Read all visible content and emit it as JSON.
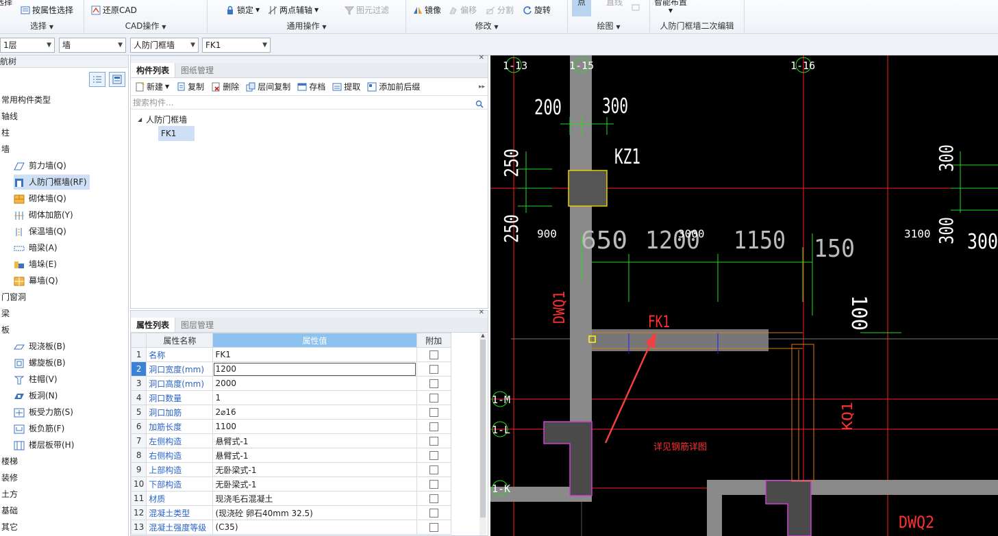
{
  "ribbon": {
    "select_group": {
      "top_partial": "选择",
      "attr_select": "按属性选择",
      "label": "选择"
    },
    "cad_group": {
      "restore_cad": "还原CAD",
      "label": "CAD操作"
    },
    "common_group": {
      "lock": "锁定",
      "two_point_axis": "两点辅轴",
      "element_filter": "图元过滤",
      "label": "通用操作"
    },
    "modify_group": {
      "mirror": "镜像",
      "offset": "偏移",
      "split": "分割",
      "rotate": "旋转",
      "label": "修改"
    },
    "draw_group": {
      "point": "点",
      "line": "直线",
      "label": "绘图"
    },
    "smart_group": {
      "smart_layout": "智能布置",
      "label": "人防门框墙二次编辑"
    }
  },
  "combos": {
    "floor": "1层",
    "category": "墙",
    "type": "人防门框墙",
    "element": "FK1"
  },
  "nav": {
    "title": "导航树",
    "items": [
      {
        "label": "常用构件类型"
      },
      {
        "label": "轴线"
      },
      {
        "label": "柱"
      },
      {
        "label": "墙"
      },
      {
        "label": "剪力墙(Q)",
        "icon": "shear-wall-icon"
      },
      {
        "label": "人防门框墙(RF)",
        "icon": "door-frame-wall-icon"
      },
      {
        "label": "砌体墙(Q)",
        "icon": "masonry-wall-icon"
      },
      {
        "label": "砌体加筋(Y)",
        "icon": "masonry-rebar-icon"
      },
      {
        "label": "保温墙(Q)",
        "icon": "insulation-wall-icon"
      },
      {
        "label": "暗梁(A)",
        "icon": "hidden-beam-icon"
      },
      {
        "label": "墙垛(E)",
        "icon": "wall-pier-icon"
      },
      {
        "label": "幕墙(Q)",
        "icon": "curtain-wall-icon"
      },
      {
        "label": "门窗洞"
      },
      {
        "label": "梁"
      },
      {
        "label": "板"
      },
      {
        "label": "现浇板(B)",
        "icon": "cast-slab-icon"
      },
      {
        "label": "螺旋板(B)",
        "icon": "spiral-slab-icon"
      },
      {
        "label": "柱帽(V)",
        "icon": "column-cap-icon"
      },
      {
        "label": "板洞(N)",
        "icon": "slab-hole-icon"
      },
      {
        "label": "板受力筋(S)",
        "icon": "slab-main-rebar-icon"
      },
      {
        "label": "板负筋(F)",
        "icon": "slab-neg-rebar-icon"
      },
      {
        "label": "楼层板带(H)",
        "icon": "slab-strip-icon"
      },
      {
        "label": "楼梯"
      },
      {
        "label": "装修"
      },
      {
        "label": "土方"
      },
      {
        "label": "基础"
      },
      {
        "label": "其它"
      }
    ]
  },
  "complist": {
    "tabs": [
      "构件列表",
      "图纸管理"
    ],
    "toolbar": {
      "new": "新建",
      "copy": "复制",
      "delete": "删除",
      "floor_copy": "层间复制",
      "archive": "存档",
      "extract": "提取",
      "add_prefix": "添加前后缀"
    },
    "search_placeholder": "搜索构件...",
    "tree_root": "人防门框墙",
    "tree_child": "FK1"
  },
  "proplist": {
    "tabs": [
      "属性列表",
      "图层管理"
    ],
    "headers": {
      "name": "属性名称",
      "value": "属性值",
      "extra": "附加"
    },
    "rows": [
      {
        "n": "1",
        "name": "名称",
        "value": "FK1"
      },
      {
        "n": "2",
        "name": "洞口宽度(mm)",
        "value": "1200"
      },
      {
        "n": "3",
        "name": "洞口高度(mm)",
        "value": "2000"
      },
      {
        "n": "4",
        "name": "洞口数量",
        "value": "1"
      },
      {
        "n": "5",
        "name": "洞口加筋",
        "value": "2⌀16"
      },
      {
        "n": "6",
        "name": "加筋长度",
        "value": "1100"
      },
      {
        "n": "7",
        "name": "左侧构造",
        "value": "悬臂式-1"
      },
      {
        "n": "8",
        "name": "右侧构造",
        "value": "悬臂式-1"
      },
      {
        "n": "9",
        "name": "上部构造",
        "value": "无卧梁式-1"
      },
      {
        "n": "10",
        "name": "下部构造",
        "value": "无卧梁式-1"
      },
      {
        "n": "11",
        "name": "材质",
        "value": "现浇毛石混凝土"
      },
      {
        "n": "12",
        "name": "混凝土类型",
        "value": "(现浇砼 卵石40mm 32.5)"
      },
      {
        "n": "13",
        "name": "混凝土强度等级",
        "value": "(C35)"
      }
    ]
  },
  "cad": {
    "axes": {
      "a13": "1-13",
      "a15": "1-15",
      "a16": "1-16",
      "aM": "1-M",
      "aL": "1-L",
      "aK": "1-K"
    },
    "dims": {
      "d200": "200",
      "d300a": "300",
      "d250a": "250",
      "d250b": "250",
      "d900": "900",
      "d650": "650",
      "d1200": "1200",
      "d3000": "3000",
      "d1150": "1150",
      "d150": "150",
      "d3100": "3100",
      "d300b": "300",
      "d300c": "300",
      "d300d": "300",
      "d100": "100"
    },
    "labels": {
      "kz1": "KZ1",
      "fk1": "FK1",
      "dwq1": "DWQ1",
      "dwq2": "DWQ2",
      "kq1": "KQ1",
      "note": "详见钢筋详图"
    },
    "colors": {
      "background": "#000000",
      "axis": "#ff2020",
      "dimension": "#22dd22",
      "wall": "#8a8a8a",
      "column_outline": "#e8d000",
      "opening": "#e07a1a",
      "annotation_arrow": "#f04040"
    }
  }
}
